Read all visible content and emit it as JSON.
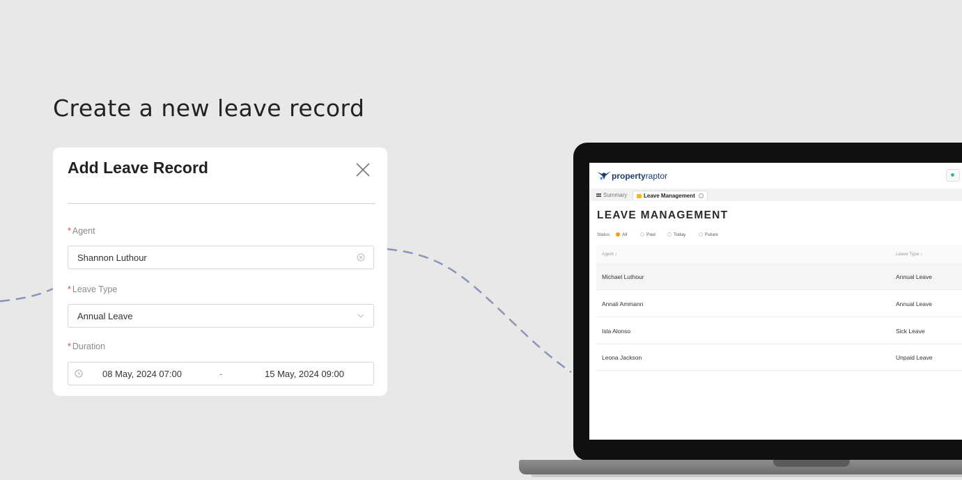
{
  "headline": "Create a new leave record",
  "modal": {
    "title": "Add Leave Record",
    "agent": {
      "label": "Agent",
      "value": "Shannon Luthour"
    },
    "leave_type": {
      "label": "Leave Type",
      "value": "Annual Leave"
    },
    "duration": {
      "label": "Duration",
      "start": "08 May, 2024 07:00",
      "separator": "-",
      "end": "15 May, 2024 09:00"
    },
    "required_mark": "*"
  },
  "app": {
    "brand_bold": "property",
    "brand_light": "raptor",
    "tabs": [
      {
        "label": "Summary"
      },
      {
        "label": "Leave Management"
      }
    ],
    "page_title": "LEAVE MANAGEMENT",
    "status": {
      "label": "Status",
      "options": [
        "All",
        "Past",
        "Today",
        "Future"
      ],
      "selected": "All"
    },
    "table": {
      "headers": [
        "Agent ↕",
        "Leave Type ↕"
      ],
      "rows": [
        {
          "agent": "Michael Luthour",
          "leave_type": "Annual Leave"
        },
        {
          "agent": "Annali Ammann",
          "leave_type": "Annual Leave"
        },
        {
          "agent": "Isla Alonso",
          "leave_type": "Sick Leave"
        },
        {
          "agent": "Leona Jackson",
          "leave_type": "Unpaid Leave"
        }
      ]
    }
  },
  "colors": {
    "background": "#e8e8e8",
    "required": "#e0453a",
    "brand": "#1e3a6e",
    "radio_selected": "#f0a020",
    "connector": "#8a93b8"
  },
  "icons": [
    "close-icon",
    "clear-icon",
    "chevron-down-icon",
    "clock-icon",
    "raptor-logo-icon",
    "summary-icon",
    "folder-icon",
    "tab-close-icon"
  ]
}
